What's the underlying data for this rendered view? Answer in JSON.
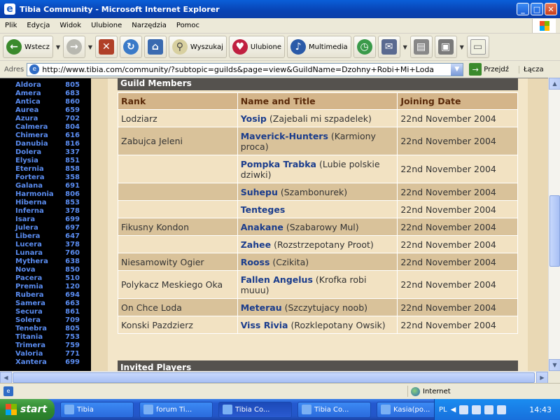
{
  "window": {
    "title": "Tibia Community - Microsoft Internet Explorer"
  },
  "menu": [
    "Plik",
    "Edycja",
    "Widok",
    "Ulubione",
    "Narzędzia",
    "Pomoc"
  ],
  "toolbar": {
    "back_label": "Wstecz",
    "search_label": "Wyszukaj",
    "favorites_label": "Ulubione",
    "media_label": "Multimedia"
  },
  "address": {
    "label": "Adres",
    "url": "http://www.tibia.com/community/?subtopic=guilds&page=view&GuildName=Dzohny+Robi+Mi+Loda",
    "go_label": "Przejdź",
    "links_label": "Łącza"
  },
  "worlds": [
    {
      "name": "Aldora",
      "count": "805"
    },
    {
      "name": "Amera",
      "count": "683"
    },
    {
      "name": "Antica",
      "count": "860"
    },
    {
      "name": "Aurea",
      "count": "659"
    },
    {
      "name": "Azura",
      "count": "702"
    },
    {
      "name": "Calmera",
      "count": "804"
    },
    {
      "name": "Chimera",
      "count": "616"
    },
    {
      "name": "Danubia",
      "count": "816"
    },
    {
      "name": "Dolera",
      "count": "337"
    },
    {
      "name": "Elysia",
      "count": "851"
    },
    {
      "name": "Eternia",
      "count": "858"
    },
    {
      "name": "Fortera",
      "count": "358"
    },
    {
      "name": "Galana",
      "count": "691"
    },
    {
      "name": "Harmonia",
      "count": "806"
    },
    {
      "name": "Hiberna",
      "count": "853"
    },
    {
      "name": "Inferna",
      "count": "378"
    },
    {
      "name": "Isara",
      "count": "699"
    },
    {
      "name": "Julera",
      "count": "697"
    },
    {
      "name": "Libera",
      "count": "647"
    },
    {
      "name": "Lucera",
      "count": "378"
    },
    {
      "name": "Lunara",
      "count": "760"
    },
    {
      "name": "Mythera",
      "count": "638"
    },
    {
      "name": "Nova",
      "count": "850"
    },
    {
      "name": "Pacera",
      "count": "510"
    },
    {
      "name": "Premia",
      "count": "120"
    },
    {
      "name": "Rubera",
      "count": "694"
    },
    {
      "name": "Samera",
      "count": "663"
    },
    {
      "name": "Secura",
      "count": "861"
    },
    {
      "name": "Solera",
      "count": "709"
    },
    {
      "name": "Tenebra",
      "count": "805"
    },
    {
      "name": "Titania",
      "count": "753"
    },
    {
      "name": "Trimera",
      "count": "759"
    },
    {
      "name": "Valoria",
      "count": "771"
    },
    {
      "name": "Xantera",
      "count": "699"
    }
  ],
  "guild": {
    "members_heading": "Guild Members",
    "invited_heading": "Invited Players",
    "columns": [
      "Rank",
      "Name and Title",
      "Joining Date"
    ],
    "rows": [
      {
        "rank": "Lodziarz",
        "name": "Yosip",
        "title": "(Zajebali mi szpadelek)",
        "date": "22nd November 2004"
      },
      {
        "rank": "Zabujca Jeleni",
        "name": "Maverick-Hunters",
        "title": "(Karmiony proca)",
        "date": "22nd November 2004"
      },
      {
        "rank": "",
        "name": "Pompka Trabka",
        "title": "(Lubie polskie dziwki)",
        "date": "22nd November 2004"
      },
      {
        "rank": "",
        "name": "Suhepu",
        "title": "(Szambonurek)",
        "date": "22nd November 2004"
      },
      {
        "rank": "",
        "name": "Tenteges",
        "title": "",
        "date": "22nd November 2004"
      },
      {
        "rank": "Fikusny Kondon",
        "name": "Anakane",
        "title": "(Szabarowy Mul)",
        "date": "22nd November 2004"
      },
      {
        "rank": "",
        "name": "Zahee",
        "title": "(Rozstrzepotany Proot)",
        "date": "22nd November 2004"
      },
      {
        "rank": "Niesamowity Ogier",
        "name": "Rooss",
        "title": "(Czikita)",
        "date": "22nd November 2004"
      },
      {
        "rank": "Polykacz Meskiego Oka",
        "name": "Fallen Angelus",
        "title": "(Krofka robi muuu)",
        "date": "22nd November 2004"
      },
      {
        "rank": "On Chce Loda",
        "name": "Meterau",
        "title": "(Szczytujacy noob)",
        "date": "22nd November 2004"
      },
      {
        "rank": "Konski Pazdzierz",
        "name": "Viss Rivia",
        "title": "(Rozklepotany Owsik)",
        "date": "22nd November 2004"
      }
    ]
  },
  "status": {
    "zone": "Internet"
  },
  "taskbar": {
    "start_label": "start",
    "tasks": [
      "Tibia",
      "forum Ti...",
      "Tibia Co...",
      "Tibia Co...",
      "Kasia(po..."
    ],
    "lang": "PL",
    "clock": "14:43"
  }
}
